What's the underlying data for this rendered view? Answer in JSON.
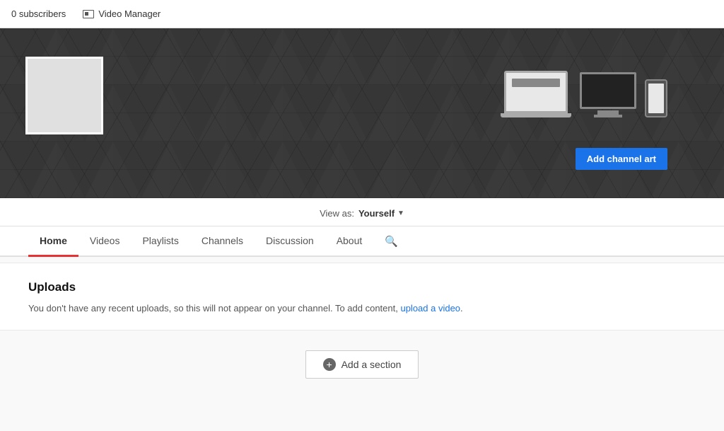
{
  "topBar": {
    "subscriberCount": "0 subscribers",
    "videoManagerLabel": "Video Manager"
  },
  "channelBanner": {
    "addChannelArtLabel": "Add channel art"
  },
  "viewAs": {
    "label": "View as:",
    "value": "Yourself"
  },
  "tabs": [
    {
      "id": "home",
      "label": "Home",
      "active": true
    },
    {
      "id": "videos",
      "label": "Videos",
      "active": false
    },
    {
      "id": "playlists",
      "label": "Playlists",
      "active": false
    },
    {
      "id": "channels",
      "label": "Channels",
      "active": false
    },
    {
      "id": "discussion",
      "label": "Discussion",
      "active": false
    },
    {
      "id": "about",
      "label": "About",
      "active": false
    }
  ],
  "uploadsSection": {
    "title": "Uploads",
    "description": "You don't have any recent uploads, so this will not appear on your channel. To add content,",
    "linkText": "upload a video",
    "descriptionSuffix": "."
  },
  "addSection": {
    "label": "Add a section",
    "plusIcon": "+"
  }
}
